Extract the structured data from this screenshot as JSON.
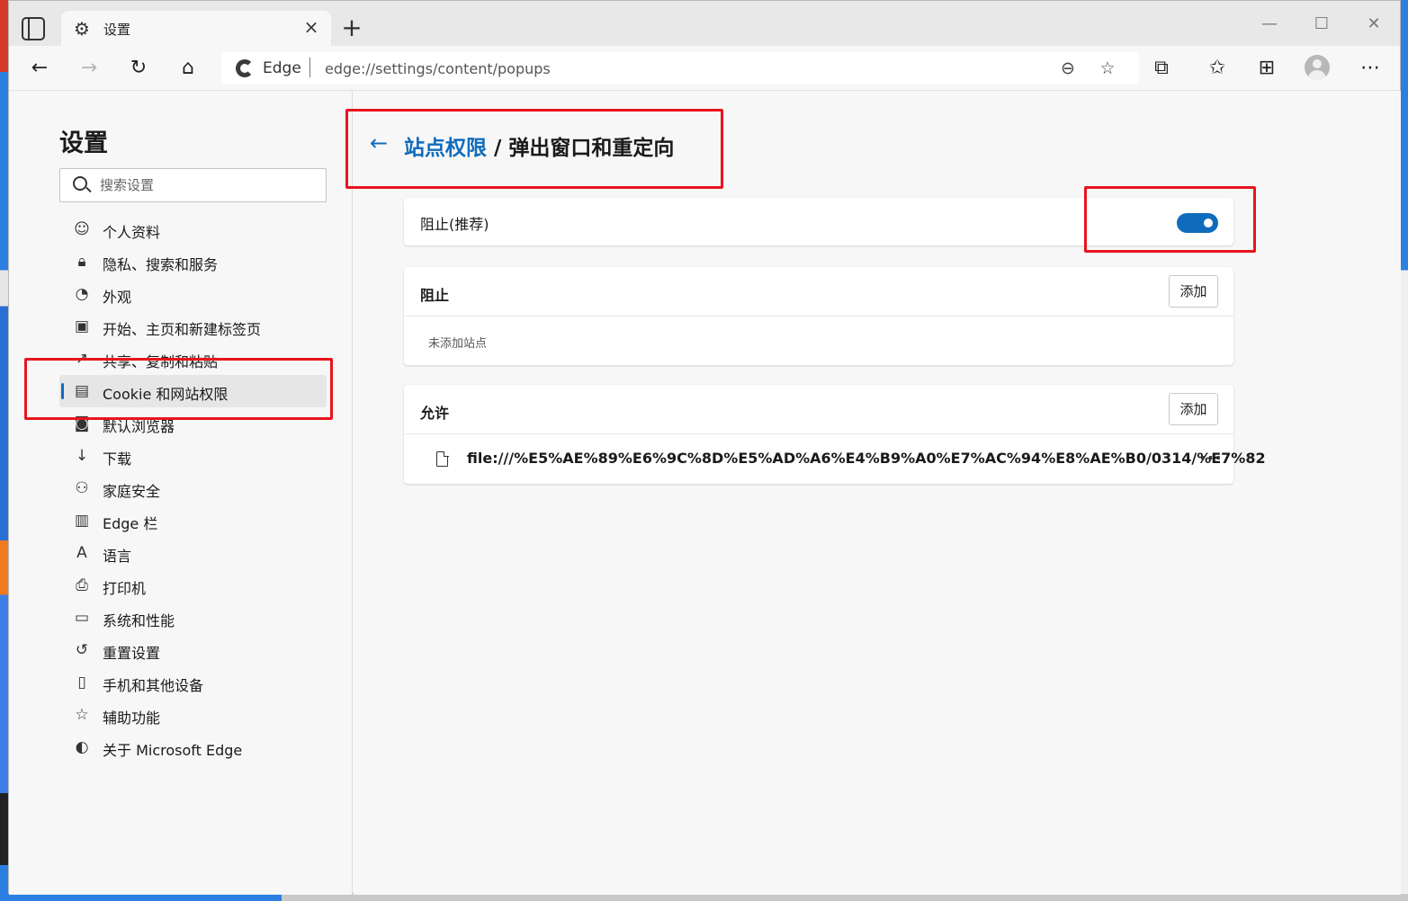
{
  "tab": {
    "title": "设置"
  },
  "address_bar": {
    "brand": "Edge",
    "url": "edge://settings/content/popups"
  },
  "sidebar": {
    "title": "设置",
    "search_placeholder": "搜索设置",
    "items": [
      {
        "label": "个人资料",
        "icon": "profile-icon",
        "glyph": "☺"
      },
      {
        "label": "隐私、搜索和服务",
        "icon": "lock-icon",
        "glyph": "🔒︎"
      },
      {
        "label": "外观",
        "icon": "palette-icon",
        "glyph": "◔"
      },
      {
        "label": "开始、主页和新建标签页",
        "icon": "home-page-icon",
        "glyph": "▣"
      },
      {
        "label": "共享、复制和粘贴",
        "icon": "share-icon",
        "glyph": "↗"
      },
      {
        "label": "Cookie 和网站权限",
        "icon": "site-permissions-icon",
        "glyph": "▤",
        "active": true
      },
      {
        "label": "默认浏览器",
        "icon": "default-browser-icon",
        "glyph": "◙"
      },
      {
        "label": "下载",
        "icon": "download-icon",
        "glyph": "↓"
      },
      {
        "label": "家庭安全",
        "icon": "family-icon",
        "glyph": "⚇"
      },
      {
        "label": "Edge 栏",
        "icon": "edge-bar-icon",
        "glyph": "▥"
      },
      {
        "label": "语言",
        "icon": "language-icon",
        "glyph": "A"
      },
      {
        "label": "打印机",
        "icon": "printer-icon",
        "glyph": "⎙"
      },
      {
        "label": "系统和性能",
        "icon": "laptop-icon",
        "glyph": "▭"
      },
      {
        "label": "重置设置",
        "icon": "reset-icon",
        "glyph": "↺"
      },
      {
        "label": "手机和其他设备",
        "icon": "phone-icon",
        "glyph": "▯"
      },
      {
        "label": "辅助功能",
        "icon": "accessibility-icon",
        "glyph": "☆"
      },
      {
        "label": "关于 Microsoft Edge",
        "icon": "edge-logo-icon",
        "glyph": "◐"
      }
    ]
  },
  "header": {
    "parent": "站点权限",
    "separator": " / ",
    "current": "弹出窗口和重定向"
  },
  "block_recommended": {
    "label": "阻止(推荐)",
    "toggle_on": true
  },
  "block_section": {
    "title": "阻止",
    "add_label": "添加",
    "empty_text": "未添加站点"
  },
  "allow_section": {
    "title": "允许",
    "add_label": "添加",
    "sites": [
      "file:///%E5%AE%89%E6%9C%8D%E5%AD%A6%E4%B9%A0%E7%AC%94%E8%AE%B0/0314/%E7%82"
    ]
  },
  "colors": {
    "accent": "#0f6cbd",
    "annotation": "#e8141e"
  }
}
